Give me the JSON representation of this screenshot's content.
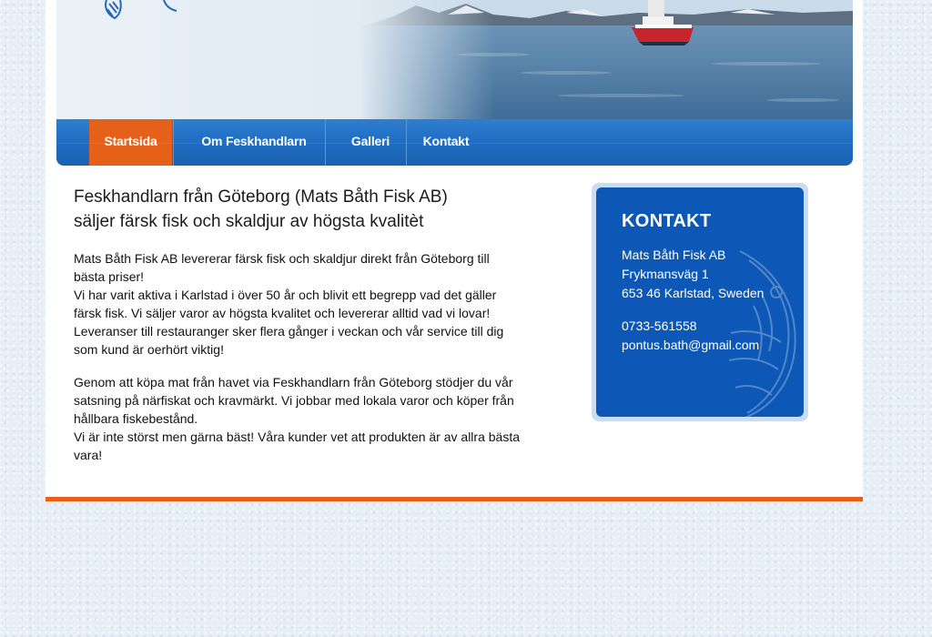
{
  "nav": {
    "items": [
      {
        "label": "Startsida"
      },
      {
        "label": "Om Feskhandlarn"
      },
      {
        "label": "Galleri"
      },
      {
        "label": "Kontakt"
      }
    ]
  },
  "main": {
    "heading_line1": "Feskhandlarn från Göteborg (Mats Båth Fisk AB)",
    "heading_line2": "säljer färsk fisk och skaldjur av högsta kvalitèt",
    "paragraph1": [
      "Mats Båth Fisk AB levererar färsk fisk och skaldjur direkt från Göteborg till",
      "bästa priser!",
      "Vi har varit aktiva i Karlstad i över 50 år och blivit ett begrepp vad det gäller",
      "färsk fisk. Vi säljer varor av högsta kvalitet och levererar alltid vad vi lovar!",
      "Leveranser till restauranger sker flera gånger i veckan och vår service till dig",
      "som kund är oerhört viktig!"
    ],
    "paragraph2": [
      "Genom att köpa mat från havet via Feskhandlarn från Göteborg stödjer du vår",
      "satsning på närfiskat och kravmärkt. Vi jobbar med lokala varor och köper från",
      "hållbara fiskebestånd.",
      "Vi är inte störst men gärna bäst! Våra kunder vet att produkten är av allra bästa",
      "vara!"
    ]
  },
  "contact": {
    "title": "KONTAKT",
    "company": "Mats Båth Fisk AB",
    "street": "Frykmansväg 1",
    "city": "653 46 Karlstad, Sweden",
    "phone": "0733-561558",
    "email": "pontus.bath@gmail.com"
  },
  "colors": {
    "accent_orange": "#e5611a",
    "nav_blue": "#1f6cc0",
    "contact_blue": "#0d58b6"
  },
  "icons": {
    "logo": "fish-logo-icon",
    "contact_background": "fish-watermark-icon"
  }
}
